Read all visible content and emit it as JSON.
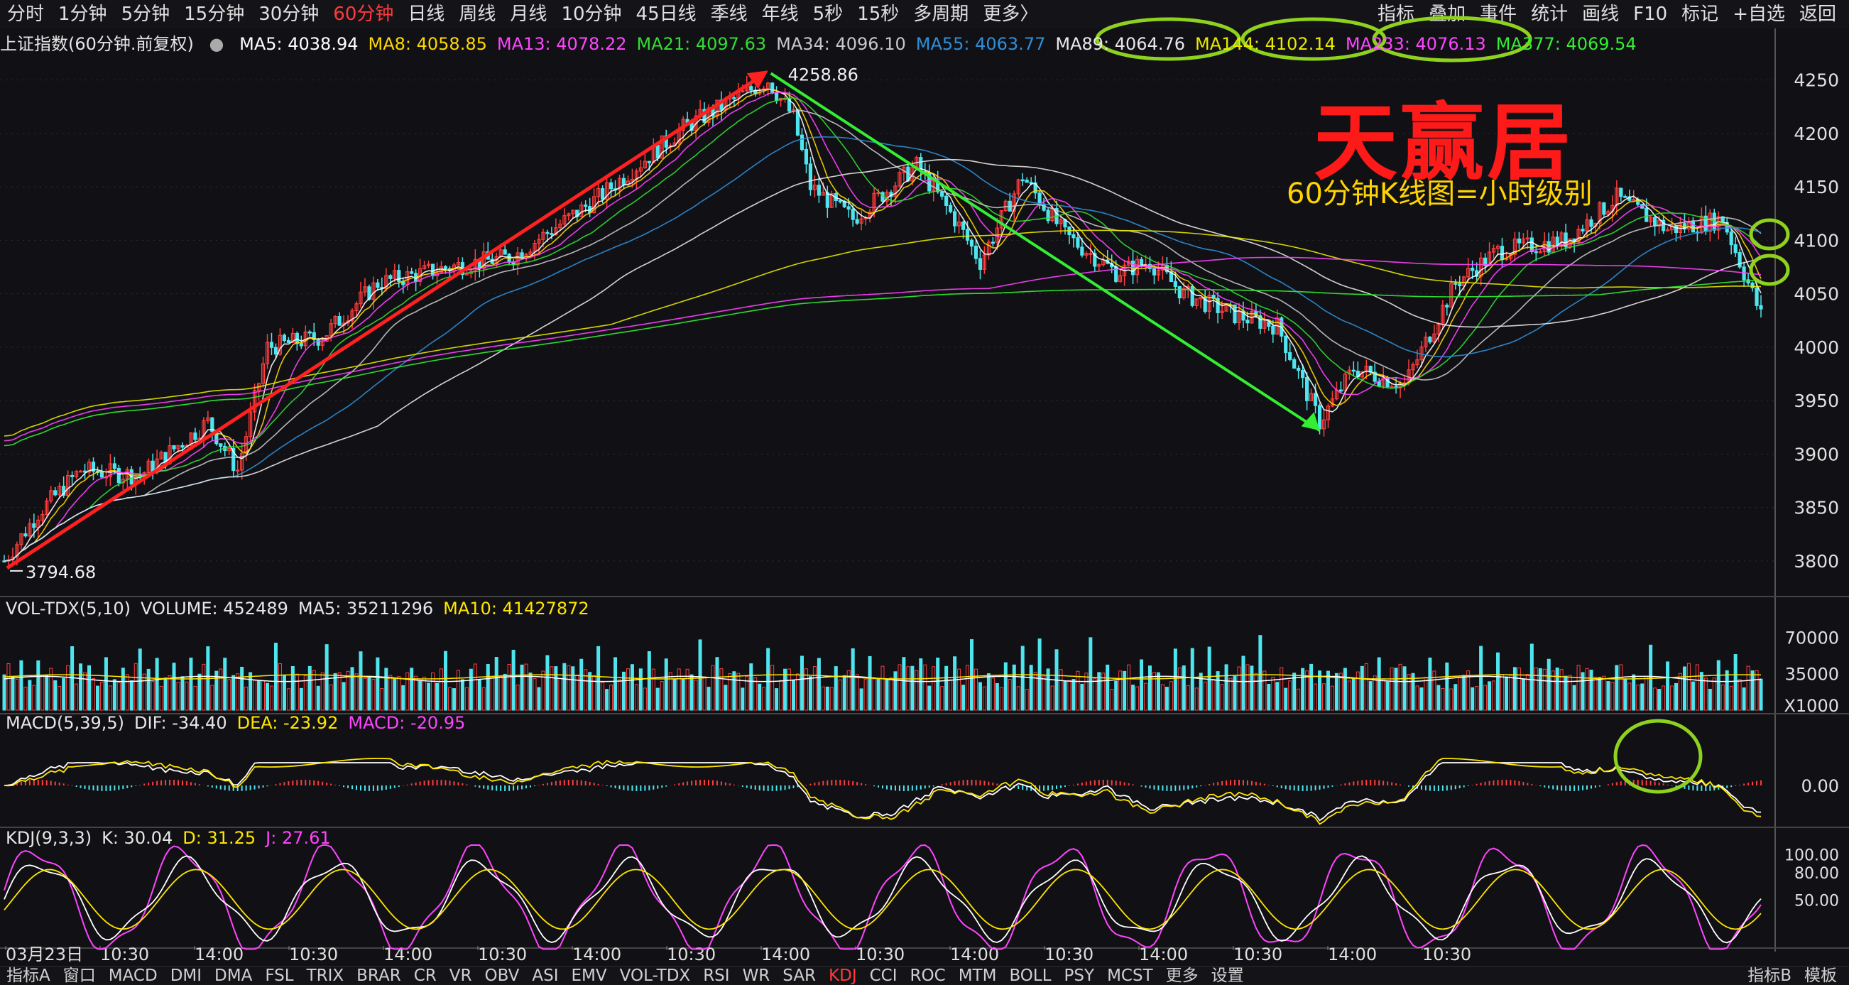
{
  "toolbar": {
    "periods": [
      "分时",
      "1分钟",
      "5分钟",
      "15分钟",
      "30分钟",
      "60分钟",
      "日线",
      "周线",
      "月线",
      "10分钟",
      "45日线",
      "季线",
      "年线",
      "5秒",
      "15秒",
      "多周期",
      "更多〉"
    ],
    "active_period": "60分钟",
    "right_items": [
      "指标",
      "叠加",
      "事件",
      "统计",
      "画线",
      "F10",
      "标记",
      "+自选",
      "返回"
    ]
  },
  "main_legend": {
    "title": "上证指数(60分钟.前复权)",
    "items": [
      {
        "label": "MA5: 4038.94",
        "color": "#ffffff"
      },
      {
        "label": "MA8: 4058.85",
        "color": "#ffd700"
      },
      {
        "label": "MA13: 4078.22",
        "color": "#ff44ff"
      },
      {
        "label": "MA21: 4097.63",
        "color": "#33dd33"
      },
      {
        "label": "MA34: 4096.10",
        "color": "#c8c8c8"
      },
      {
        "label": "MA55: 4063.77",
        "color": "#2f8fd8"
      },
      {
        "label": "MA89: 4064.76",
        "color": "#e8e8e8"
      },
      {
        "label": "MA144: 4102.14",
        "color": "#e8e800"
      },
      {
        "label": "MA233: 4076.13",
        "color": "#ff44ff"
      },
      {
        "label": "MA377: 4069.54",
        "color": "#33ee33"
      }
    ]
  },
  "annotations": {
    "brand": "天赢居",
    "subtitle": "60分钟K线图=小时级别",
    "high_label": "4258.86",
    "low_label": "3794.68"
  },
  "vol_legend": {
    "items": [
      {
        "label": "VOL-TDX(5,10)",
        "color": "#e6e6e6"
      },
      {
        "label": "VOLUME: 452489",
        "color": "#e6e6e6"
      },
      {
        "label": "MA5: 35211296",
        "color": "#e6e6e6"
      },
      {
        "label": "MA10: 41427872",
        "color": "#ffe600"
      }
    ],
    "unit": "X1000"
  },
  "macd_legend": {
    "items": [
      {
        "label": "MACD(5,39,5)",
        "color": "#e6e6e6"
      },
      {
        "label": "DIF: -34.40",
        "color": "#e6e6e6"
      },
      {
        "label": "DEA: -23.92",
        "color": "#ffe600"
      },
      {
        "label": "MACD: -20.95",
        "color": "#ff44ff"
      }
    ]
  },
  "kdj_legend": {
    "items": [
      {
        "label": "KDJ(9,3,3)",
        "color": "#e6e6e6"
      },
      {
        "label": "K: 30.04",
        "color": "#e6e6e6"
      },
      {
        "label": "D: 31.25",
        "color": "#ffe600"
      },
      {
        "label": "J: 27.61",
        "color": "#ff44ff"
      }
    ]
  },
  "bottombar": {
    "items": [
      "指标A",
      "窗口",
      "MACD",
      "DMI",
      "DMA",
      "FSL",
      "TRIX",
      "BRAR",
      "CR",
      "VR",
      "OBV",
      "ASI",
      "EMV",
      "VOL-TDX",
      "RSI",
      "WR",
      "SAR",
      "KDJ",
      "CCI",
      "ROC",
      "MTM",
      "BOLL",
      "PSY",
      "MCST",
      "更多",
      "设置"
    ],
    "active": "KDJ",
    "right_items": [
      "指标B",
      "模板"
    ]
  },
  "colors": {
    "up": "#ff3d3d",
    "down": "#4fe5ee",
    "bg": "#111115",
    "grid": "#2c2c33"
  },
  "chart_data": [
    {
      "type": "candlestick",
      "title": "上证指数(60分钟.前复权)",
      "ylim": [
        3770,
        4275
      ],
      "yticks": [
        3800,
        3850,
        3900,
        3950,
        4000,
        4050,
        4100,
        4150,
        4200,
        4250
      ],
      "xticks": [
        "03月23日",
        "10:30",
        "14:00",
        "10:30",
        "14:00",
        "10:30",
        "14:00",
        "10:30",
        "14:00",
        "10:30",
        "14:00",
        "10:30",
        "14:00",
        "10:30",
        "14:00",
        "10:30"
      ],
      "trend": {
        "start_bar": 0,
        "end_bar": 345,
        "key_points": [
          [
            0,
            3800
          ],
          [
            8,
            3845
          ],
          [
            18,
            3885
          ],
          [
            32,
            3880
          ],
          [
            48,
            3930
          ],
          [
            55,
            3885
          ],
          [
            62,
            4000
          ],
          [
            75,
            4010
          ],
          [
            88,
            4060
          ],
          [
            105,
            4075
          ],
          [
            120,
            4085
          ],
          [
            140,
            4140
          ],
          [
            160,
            4205
          ],
          [
            180,
            4250
          ],
          [
            186,
            4215
          ],
          [
            190,
            4150
          ],
          [
            200,
            4120
          ],
          [
            215,
            4170
          ],
          [
            224,
            4120
          ],
          [
            230,
            4080
          ],
          [
            240,
            4160
          ],
          [
            250,
            4105
          ],
          [
            262,
            4070
          ],
          [
            270,
            4080
          ],
          [
            278,
            4050
          ],
          [
            290,
            4030
          ],
          [
            300,
            4020
          ],
          [
            310,
            3930
          ],
          [
            318,
            3980
          ],
          [
            330,
            3965
          ],
          [
            342,
            4060
          ],
          [
            352,
            4090
          ],
          [
            368,
            4100
          ],
          [
            380,
            4140
          ],
          [
            392,
            4110
          ],
          [
            405,
            4120
          ],
          [
            415,
            4020
          ]
        ],
        "n_bars": 415
      },
      "moving_averages": [
        {
          "name": "MA5",
          "value": 4038.94
        },
        {
          "name": "MA8",
          "value": 4058.85
        },
        {
          "name": "MA13",
          "value": 4078.22
        },
        {
          "name": "MA21",
          "value": 4097.63
        },
        {
          "name": "MA34",
          "value": 4096.1
        },
        {
          "name": "MA55",
          "value": 4063.77
        },
        {
          "name": "MA89",
          "value": 4064.76
        },
        {
          "name": "MA144",
          "value": 4102.14
        },
        {
          "name": "MA233",
          "value": 4076.13
        },
        {
          "name": "MA377",
          "value": 4069.54
        }
      ],
      "high": 4258.86,
      "low": 3794.68
    },
    {
      "type": "bar",
      "title": "VOL-TDX(5,10)",
      "yticks": [
        35000,
        70000
      ],
      "ylim": [
        0,
        90000
      ],
      "unit": "X1000"
    },
    {
      "type": "bar",
      "title": "MACD(5,39,5)",
      "yticks": [
        0.0
      ],
      "dif": -34.4,
      "dea": -23.92,
      "macd": -20.95
    },
    {
      "type": "line",
      "title": "KDJ(9,3,3)",
      "yticks": [
        50.0,
        80.0,
        100.0
      ],
      "k": 30.04,
      "d": 31.25,
      "j": 27.61
    }
  ]
}
